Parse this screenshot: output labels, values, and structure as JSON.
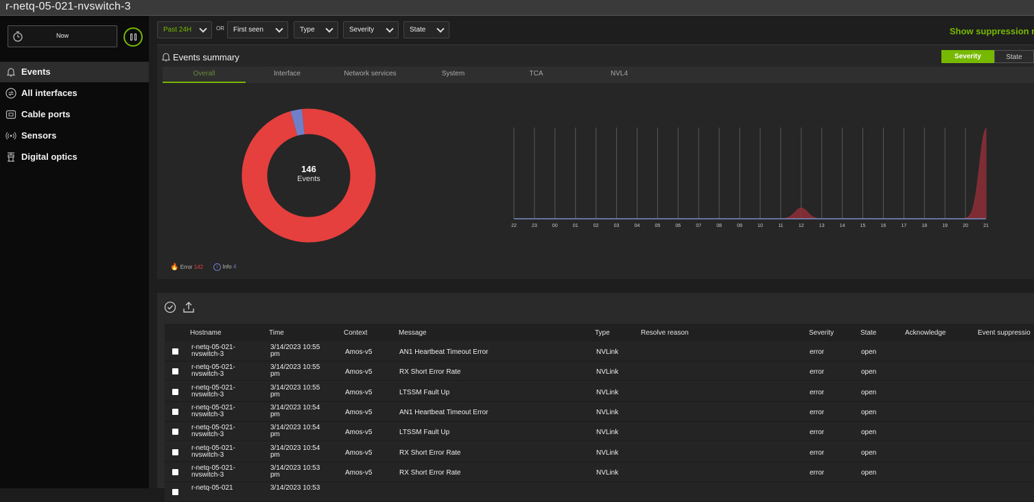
{
  "window": {
    "title": "r-netq-05-021-nvswitch-3"
  },
  "sidebar": {
    "now_label": "Now",
    "items": [
      {
        "label": "Events",
        "icon": "bell-icon"
      },
      {
        "label": "All interfaces",
        "icon": "interfaces-icon"
      },
      {
        "label": "Cable ports",
        "icon": "cable-port-icon"
      },
      {
        "label": "Sensors",
        "icon": "sensor-icon"
      },
      {
        "label": "Digital optics",
        "icon": "optics-icon"
      }
    ]
  },
  "filters": {
    "time": "Past 24H",
    "or_label": "OR",
    "first_seen": "First seen",
    "type": "Type",
    "severity": "Severity",
    "state": "State",
    "show_suppression": "Show suppression r"
  },
  "summary": {
    "title": "Events summary",
    "toggle": {
      "severity": "Severity",
      "state": "State",
      "selected": "Severity"
    },
    "tabs": [
      "Overall",
      "Interface",
      "Network services",
      "System",
      "TCA",
      "NVL4"
    ],
    "active_tab": "Overall",
    "total": "146",
    "total_label": "Events",
    "legend": {
      "error_label": "Error",
      "error_count": "142",
      "info_label": "Info",
      "info_count": "4"
    }
  },
  "chart_data": {
    "type": "area",
    "donut": {
      "type": "pie",
      "labels": [
        "Error",
        "Info"
      ],
      "values": [
        142,
        4
      ],
      "colors": [
        "#e5403d",
        "#6f7fc8"
      ]
    },
    "x": [
      "22",
      "23",
      "00",
      "01",
      "02",
      "03",
      "04",
      "05",
      "06",
      "07",
      "08",
      "09",
      "10",
      "11",
      "12",
      "13",
      "14",
      "15",
      "16",
      "17",
      "18",
      "19",
      "20",
      "21"
    ],
    "series": [
      {
        "values": [
          0,
          0,
          0,
          0,
          0,
          0,
          0,
          0,
          0,
          0,
          0,
          0,
          0,
          0,
          12,
          0,
          0,
          0,
          0,
          0,
          0,
          0,
          0,
          100
        ]
      }
    ],
    "colors": {
      "area": "#8e2f38",
      "line": "#7a8dc8"
    },
    "grid": "vertical"
  },
  "table": {
    "columns": [
      "Hostname",
      "Time",
      "Context",
      "Message",
      "Type",
      "Resolve reason",
      "Severity",
      "State",
      "Acknowledge",
      "Event suppressio"
    ],
    "rows": [
      {
        "host1": "r-netq-05-021-",
        "host2": "nvswitch-3",
        "time1": "3/14/2023 10:55",
        "time2": "pm",
        "context": "Amos-v5",
        "message": "AN1 Heartbeat Timeout Error",
        "type": "NVLink",
        "severity": "error",
        "state": "open"
      },
      {
        "host1": "r-netq-05-021-",
        "host2": "nvswitch-3",
        "time1": "3/14/2023 10:55",
        "time2": "pm",
        "context": "Amos-v5",
        "message": "RX Short Error Rate",
        "type": "NVLink",
        "severity": "error",
        "state": "open"
      },
      {
        "host1": "r-netq-05-021-",
        "host2": "nvswitch-3",
        "time1": "3/14/2023 10:55",
        "time2": "pm",
        "context": "Amos-v5",
        "message": "LTSSM Fault Up",
        "type": "NVLink",
        "severity": "error",
        "state": "open"
      },
      {
        "host1": "r-netq-05-021-",
        "host2": "nvswitch-3",
        "time1": "3/14/2023 10:54",
        "time2": "pm",
        "context": "Amos-v5",
        "message": "AN1 Heartbeat Timeout Error",
        "type": "NVLink",
        "severity": "error",
        "state": "open"
      },
      {
        "host1": "r-netq-05-021-",
        "host2": "nvswitch-3",
        "time1": "3/14/2023 10:54",
        "time2": "pm",
        "context": "Amos-v5",
        "message": "LTSSM Fault Up",
        "type": "NVLink",
        "severity": "error",
        "state": "open"
      },
      {
        "host1": "r-netq-05-021-",
        "host2": "nvswitch-3",
        "time1": "3/14/2023 10:54",
        "time2": "pm",
        "context": "Amos-v5",
        "message": "RX Short Error Rate",
        "type": "NVLink",
        "severity": "error",
        "state": "open"
      },
      {
        "host1": "r-netq-05-021-",
        "host2": "nvswitch-3",
        "time1": "3/14/2023 10:53",
        "time2": "pm",
        "context": "Amos-v5",
        "message": "RX Short Error Rate",
        "type": "NVLink",
        "severity": "error",
        "state": "open"
      },
      {
        "host1": "r-netq-05-021",
        "host2": "",
        "time1": "3/14/2023 10:53",
        "time2": "",
        "context": "",
        "message": "",
        "type": "",
        "severity": "",
        "state": ""
      }
    ]
  }
}
